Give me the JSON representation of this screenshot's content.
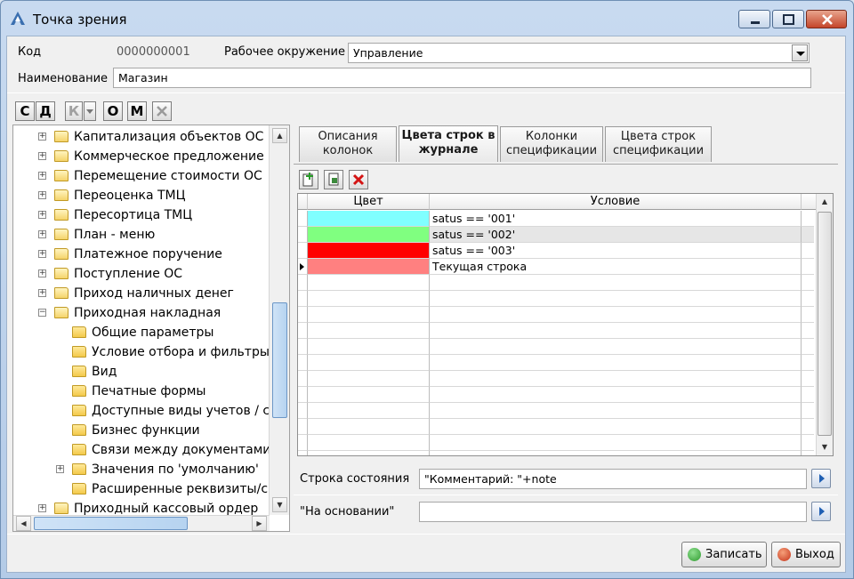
{
  "window": {
    "title": "Точка зрения"
  },
  "form": {
    "code_label": "Код",
    "code_value": "0000000001",
    "env_label": "Рабочее окружение",
    "env_value": "Управление",
    "name_label": "Наименование",
    "name_value": "Магазин"
  },
  "toolbar": {
    "buttons": [
      "С",
      "Д",
      "К",
      "О",
      "М"
    ]
  },
  "tree": {
    "items": [
      {
        "label": "Капитализация объектов ОС",
        "level": 1,
        "expander": "+"
      },
      {
        "label": "Коммерческое предложение",
        "level": 1,
        "expander": "+"
      },
      {
        "label": "Перемещение стоимости ОС",
        "level": 1,
        "expander": "+"
      },
      {
        "label": "Переоценка ТМЦ",
        "level": 1,
        "expander": "+"
      },
      {
        "label": "Пересортица ТМЦ",
        "level": 1,
        "expander": "+"
      },
      {
        "label": "План - меню",
        "level": 1,
        "expander": "+"
      },
      {
        "label": "Платежное поручение",
        "level": 1,
        "expander": "+"
      },
      {
        "label": "Поступление ОС",
        "level": 1,
        "expander": "+"
      },
      {
        "label": "Приход наличных денег",
        "level": 1,
        "expander": "+"
      },
      {
        "label": "Приходная накладная",
        "level": 1,
        "expander": "−"
      },
      {
        "label": "Общие параметры",
        "level": 2,
        "expander": ""
      },
      {
        "label": "Условие отбора и фильтры",
        "level": 2,
        "expander": ""
      },
      {
        "label": "Вид",
        "level": 2,
        "expander": ""
      },
      {
        "label": "Печатные формы",
        "level": 2,
        "expander": ""
      },
      {
        "label": "Доступные виды учетов / ста",
        "level": 2,
        "expander": ""
      },
      {
        "label": "Бизнес функции",
        "level": 2,
        "expander": ""
      },
      {
        "label": "Связи между документами",
        "level": 2,
        "expander": ""
      },
      {
        "label": "Значения по 'умолчанию'",
        "level": 2,
        "expander": "+"
      },
      {
        "label": "Расширенные реквизиты/сво",
        "level": 2,
        "expander": ""
      },
      {
        "label": "Приходный кассовый ордер",
        "level": 1,
        "expander": "+"
      }
    ]
  },
  "tabs": [
    {
      "line1": "Описания",
      "line2": "колонок"
    },
    {
      "line1": "Цвета строк в",
      "line2": "журнале"
    },
    {
      "line1": "Колонки",
      "line2": "спецификации"
    },
    {
      "line1": "Цвета строк",
      "line2": "спецификации"
    }
  ],
  "grid": {
    "headers": {
      "color": "Цвет",
      "condition": "Условие"
    },
    "rows": [
      {
        "color": "#80ffff",
        "condition": "satus == '001'"
      },
      {
        "color": "#80ff80",
        "condition": "satus == '002'"
      },
      {
        "color": "#ff0000",
        "condition": "satus == '003'"
      },
      {
        "color": "#ff8080",
        "condition": "Текущая строка"
      }
    ]
  },
  "status": {
    "label": "Строка состояния",
    "value": "\"Комментарий: \"+note"
  },
  "basis": {
    "label": "\"На основании\"",
    "value": ""
  },
  "buttons": {
    "save": "Записать",
    "exit": "Выход"
  }
}
